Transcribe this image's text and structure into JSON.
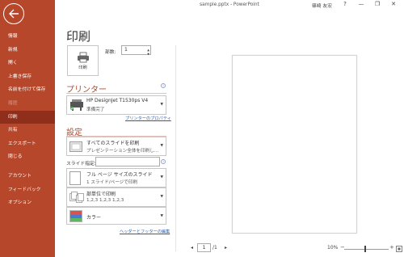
{
  "titlebar": {
    "title": "sample.pptx  -  PowerPoint",
    "signin": "篠崎 友宏",
    "help": "?",
    "minimize": "—",
    "restore": "❐",
    "close": "✕"
  },
  "sidebar": {
    "back_icon": "arrow-left-icon",
    "items": [
      {
        "label": "情報"
      },
      {
        "label": "新規"
      },
      {
        "label": "開く"
      },
      {
        "label": "上書き保存"
      },
      {
        "label": "名前を付けて保存"
      },
      {
        "label": "履歴"
      },
      {
        "label": "印刷"
      },
      {
        "label": "共有"
      },
      {
        "label": "エクスポート"
      },
      {
        "label": "閉じる"
      },
      {
        "label": "アカウント"
      },
      {
        "label": "フィードバック"
      },
      {
        "label": "オプション"
      }
    ],
    "active_index": 6,
    "accent": "#b7472a"
  },
  "main": {
    "heading": "印刷",
    "print_button": {
      "label": "印刷"
    },
    "copies": {
      "label": "部数:",
      "value": "1"
    },
    "printer_section": {
      "title": "プリンター",
      "printer_name": "HP DesignJet T1530ps V4",
      "status": "準備完了",
      "properties_link": "プリンターのプロパティ"
    },
    "settings_section": {
      "title": "設定",
      "range": {
        "line1": "すべてのスライドを印刷",
        "line2": "プレゼンテーション全体を印刷し..."
      },
      "slide_label": "スライド指定:",
      "slide_value": "",
      "layout": {
        "line1": "フル ページ サイズのスライド",
        "line2": "1 スライド/ページで印刷"
      },
      "collate": {
        "line1": "部単位で印刷",
        "line2": "1,2,3     1,2,3     1,2,3"
      },
      "color": {
        "line1": "カラー"
      },
      "header_footer_link": "ヘッダーとフッターの編集"
    }
  },
  "preview": {
    "page_current": "1",
    "page_total": "/1",
    "prev": "◂",
    "next": "▸",
    "zoom": "10%",
    "zoom_out": "−",
    "zoom_in": "+",
    "fit_icon": "fit-page-icon"
  }
}
